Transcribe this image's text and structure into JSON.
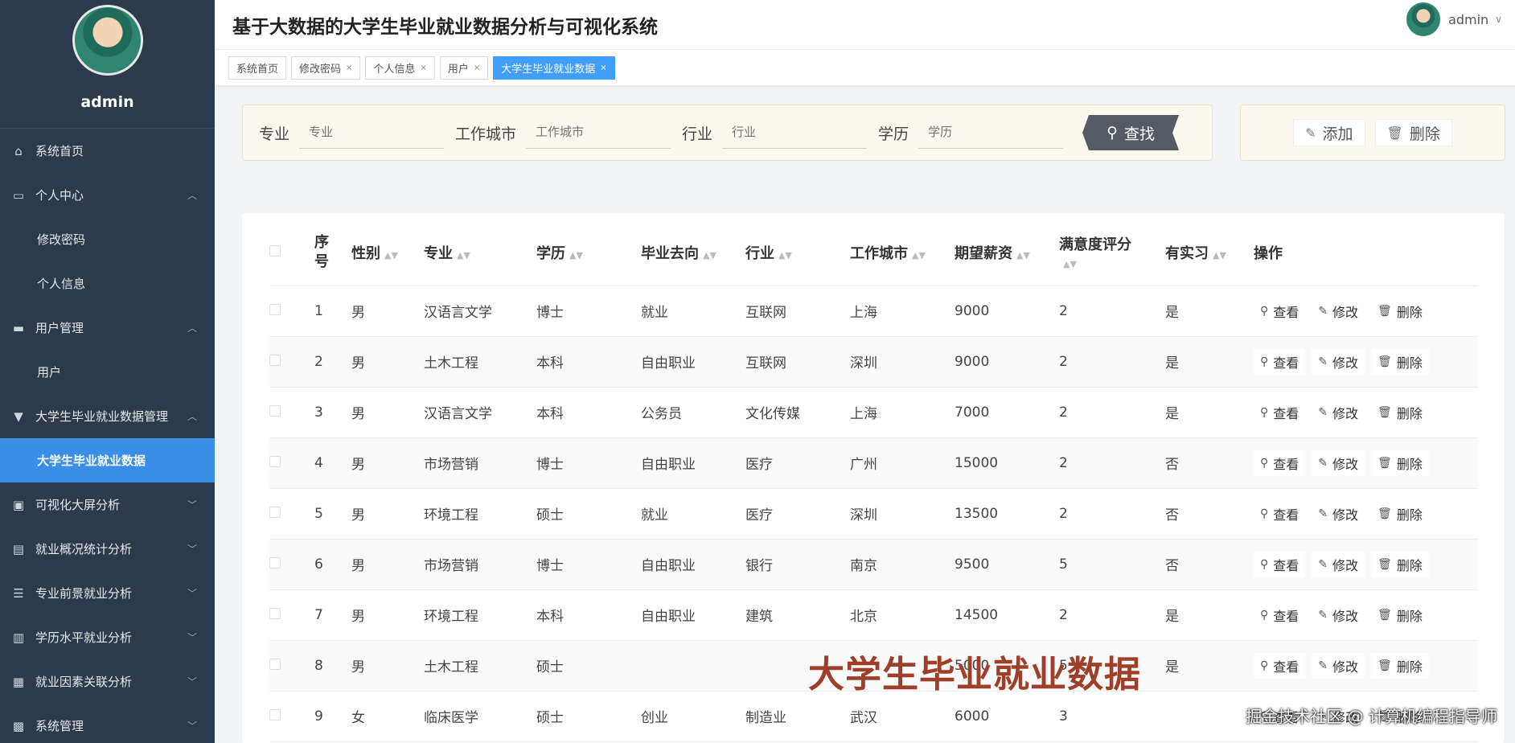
{
  "app": {
    "title": "基于大数据的大学生毕业就业数据分析与可视化系统"
  },
  "user": {
    "name": "admin"
  },
  "sidebar": {
    "profile_name": "admin",
    "items": [
      {
        "label": "系统首页",
        "icon": "home-icon",
        "expanded": false,
        "level": 0
      },
      {
        "label": "个人中心",
        "icon": "id-card-icon",
        "expanded": true,
        "level": 0
      },
      {
        "label": "修改密码",
        "level": 1
      },
      {
        "label": "个人信息",
        "level": 1
      },
      {
        "label": "用户管理",
        "icon": "briefcase-icon",
        "expanded": true,
        "level": 0
      },
      {
        "label": "用户",
        "level": 1
      },
      {
        "label": "大学生毕业就业数据管理",
        "icon": "data-icon",
        "expanded": true,
        "level": 0
      },
      {
        "label": "大学生毕业就业数据",
        "level": 1,
        "active": true
      },
      {
        "label": "可视化大屏分析",
        "icon": "clipboard-icon",
        "expanded": false,
        "level": 0
      },
      {
        "label": "就业概况统计分析",
        "icon": "printer-icon",
        "expanded": false,
        "level": 0
      },
      {
        "label": "专业前景就业分析",
        "icon": "sliders-icon",
        "expanded": false,
        "level": 0
      },
      {
        "label": "学历水平就业分析",
        "icon": "bar-icon",
        "expanded": false,
        "level": 0
      },
      {
        "label": "就业因素关联分析",
        "icon": "grid-icon",
        "expanded": false,
        "level": 0
      },
      {
        "label": "系统管理",
        "icon": "apps-icon",
        "expanded": false,
        "level": 0
      }
    ]
  },
  "tabs": [
    {
      "label": "系统首页",
      "closable": false
    },
    {
      "label": "修改密码",
      "closable": true
    },
    {
      "label": "个人信息",
      "closable": true
    },
    {
      "label": "用户",
      "closable": true
    },
    {
      "label": "大学生毕业就业数据",
      "closable": true,
      "active": true
    }
  ],
  "search": {
    "fields": [
      {
        "label": "专业",
        "placeholder": "专业"
      },
      {
        "label": "工作城市",
        "placeholder": "工作城市"
      },
      {
        "label": "行业",
        "placeholder": "行业"
      },
      {
        "label": "学历",
        "placeholder": "学历"
      }
    ],
    "query_label": "查找"
  },
  "actions": {
    "add_label": "添加",
    "delete_label": "删除"
  },
  "table": {
    "headers": {
      "index": "序号",
      "gender": "性别",
      "major": "专业",
      "degree": "学历",
      "destination": "毕业去向",
      "industry": "行业",
      "city": "工作城市",
      "salary": "期望薪资",
      "satisfaction": "满意度评分",
      "internship": "有实习",
      "ops": "操作"
    },
    "row_actions": {
      "view": "查看",
      "edit": "修改",
      "delete": "删除"
    },
    "rows": [
      [
        "1",
        "男",
        "汉语言文学",
        "博士",
        "就业",
        "互联网",
        "上海",
        "9000",
        "2",
        "是"
      ],
      [
        "2",
        "男",
        "土木工程",
        "本科",
        "自由职业",
        "互联网",
        "深圳",
        "9000",
        "2",
        "是"
      ],
      [
        "3",
        "男",
        "汉语言文学",
        "本科",
        "公务员",
        "文化传媒",
        "上海",
        "7000",
        "2",
        "是"
      ],
      [
        "4",
        "男",
        "市场营销",
        "博士",
        "自由职业",
        "医疗",
        "广州",
        "15000",
        "2",
        "否"
      ],
      [
        "5",
        "男",
        "环境工程",
        "硕士",
        "就业",
        "医疗",
        "深圳",
        "13500",
        "2",
        "否"
      ],
      [
        "6",
        "男",
        "市场营销",
        "博士",
        "自由职业",
        "银行",
        "南京",
        "9500",
        "5",
        "否"
      ],
      [
        "7",
        "男",
        "环境工程",
        "本科",
        "自由职业",
        "建筑",
        "北京",
        "14500",
        "2",
        "是"
      ],
      [
        "8",
        "男",
        "土木工程",
        "硕士",
        "",
        "",
        "",
        "5000",
        "5",
        "是"
      ],
      [
        "9",
        "女",
        "临床医学",
        "硕士",
        "创业",
        "制造业",
        "武汉",
        "6000",
        "3",
        ""
      ]
    ]
  },
  "overlay": {
    "caption": "大学生毕业就业数据"
  },
  "watermark": {
    "text": "掘金技术社区 @ 计算机编程指导师"
  }
}
